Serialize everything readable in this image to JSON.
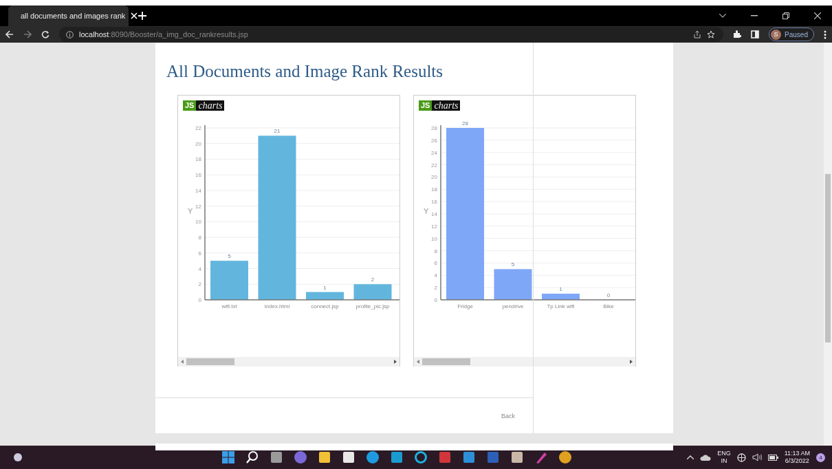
{
  "browser": {
    "tab_title": "all documents and images rank",
    "url_host": "localhost",
    "url_path": ":8090/Booster/a_img_doc_rankresults.jsp",
    "profile_initial": "S",
    "profile_status": "Paused"
  },
  "page": {
    "title": "All Documents and Image Rank Results",
    "back_link": "Back"
  },
  "charts": [
    {
      "logo": {
        "left": "JS",
        "right": "charts"
      },
      "chart_data": {
        "type": "bar",
        "ylabel": "Y",
        "categories": [
          "wifi.txt",
          "index.html",
          "connect.jsp",
          "profile_pic.jsp"
        ],
        "series": [
          {
            "color": "#62b6de",
            "values": [
              5,
              21,
              1,
              2
            ]
          }
        ],
        "grid": true,
        "ylim": [
          0,
          22
        ],
        "yticks": [
          0,
          2,
          4,
          6,
          8,
          10,
          12,
          14,
          16,
          18,
          20,
          22
        ],
        "data_labels": true
      }
    },
    {
      "logo": {
        "left": "JS",
        "right": "charts"
      },
      "chart_data": {
        "type": "bar",
        "ylabel": "Y",
        "categories": [
          "Fridge",
          "pendrive",
          "Tp Link wifi",
          "Bike"
        ],
        "series": [
          {
            "color": "#7fa7f7",
            "values": [
              28,
              5,
              1,
              0
            ]
          }
        ],
        "grid": true,
        "ylim": [
          0,
          28
        ],
        "yticks": [
          0,
          2,
          4,
          6,
          8,
          10,
          12,
          14,
          16,
          18,
          20,
          22,
          24,
          26,
          28
        ],
        "data_labels": true
      }
    }
  ],
  "taskbar": {
    "language": "ENG",
    "region": "IN",
    "time": "11:13 AM",
    "date": "6/3/2022",
    "notification_count": "4"
  }
}
